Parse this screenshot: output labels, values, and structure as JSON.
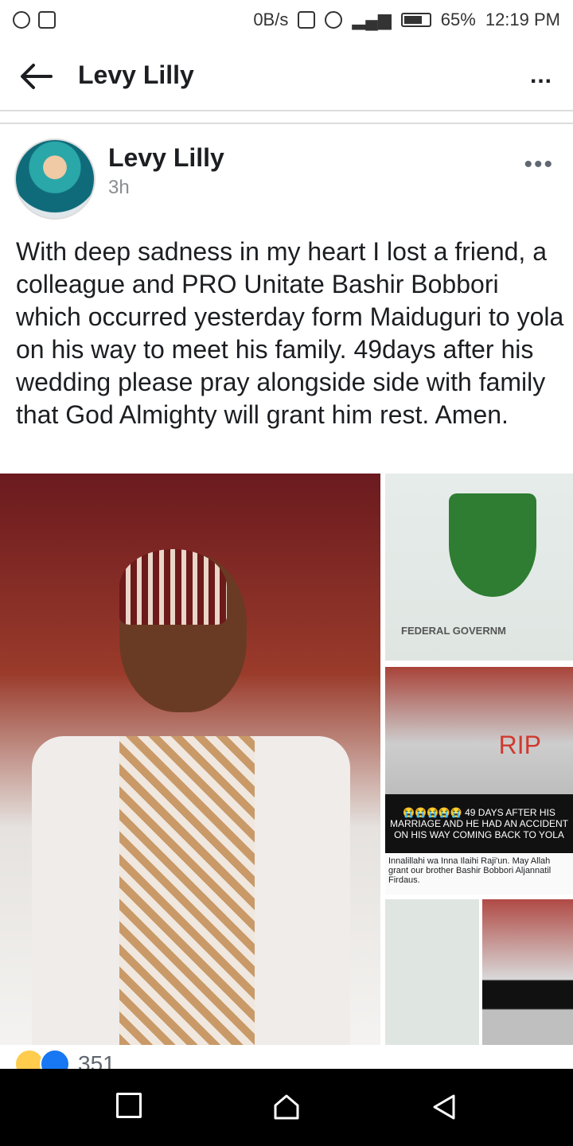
{
  "status_bar": {
    "net_speed": "0B/s",
    "battery": "65%",
    "time": "12:19 PM"
  },
  "topbar": {
    "title": "Levy Lilly",
    "more": "..."
  },
  "post": {
    "author": "Levy Lilly",
    "time": "3h",
    "more": "•••",
    "text": "With deep sadness in my heart I lost a friend, a colleague and PRO  Unitate Bashir Bobbori which occurred yesterday form Maiduguri to yola on his way to meet his family. 49days after his wedding please pray alongside side with family that God Almighty will grant him rest. Amen.",
    "photos": {
      "main_alt": "",
      "p2_caption": "FEDERAL GOVERNM",
      "p3_rip": "RIP",
      "p3_banner": "😭😭😭😭😭 49 DAYS AFTER HIS MARRIAGE AND HE HAD AN ACCIDENT ON HIS WAY COMING BACK TO YOLA",
      "p3_note": "Innalillahi wa Inna Ilaihi Raji'un. May Allah grant our brother Bashir Bobbori Aljannatil Firdaus."
    },
    "reactions_count": "351"
  }
}
